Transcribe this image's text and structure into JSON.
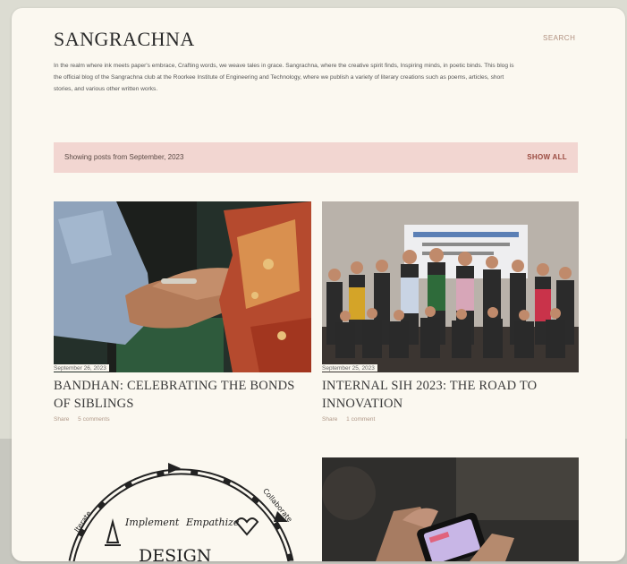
{
  "site": {
    "title": "SANGRACHNA",
    "search_label": "SEARCH",
    "description": "In the realm where ink meets paper's embrace, Crafting words, we weave tales in grace. Sangrachna, where the creative spirit finds, Inspiring minds, in poetic binds. This blog is the official blog of the Sangrachna club at the Roorkee Institute of Engineering and Technology, where we publish a variety of literary creations such as poems, articles, short stories, and various other written works."
  },
  "filter": {
    "text": "Showing posts from September, 2023",
    "show_all": "SHOW ALL"
  },
  "posts": [
    {
      "date": "September 26, 2023",
      "title": "BANDHAN: CELEBRATING THE BONDS OF SIBLINGS",
      "share": "Share",
      "comments": "5 comments"
    },
    {
      "date": "September 25, 2023",
      "title": "INTERNAL SIH 2023: THE ROAD TO INNOVATION",
      "share": "Share",
      "comments": "1 comment"
    },
    {
      "title": "",
      "image_text": {
        "implement": "Implement",
        "empathize": "Empathize",
        "design": "DESIGN",
        "iterate": "Iterate",
        "collaborate": "Collaborate"
      }
    },
    {
      "title": ""
    }
  ],
  "colors": {
    "accent": "#9a4a40",
    "filter_bg": "#f2d6d1",
    "card_bg": "#fbf8f0"
  }
}
